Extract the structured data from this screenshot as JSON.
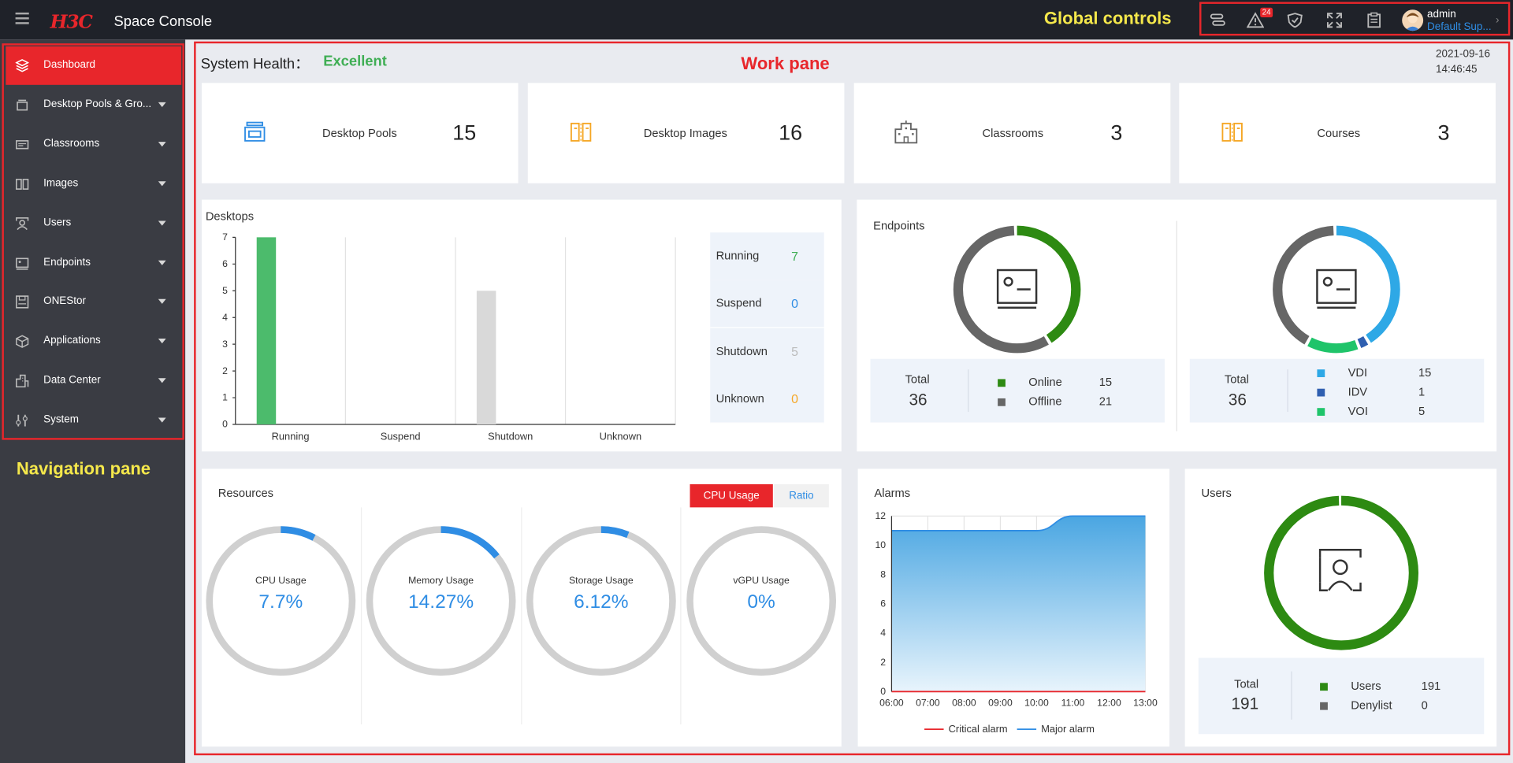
{
  "header": {
    "logo": "H3C",
    "title": "Space Console",
    "alarm_count": "24",
    "user_name": "admin",
    "user_role": "Default Sup...",
    "icons": [
      "task-icon",
      "alarm-icon",
      "shield-icon",
      "fullscreen-icon",
      "clipboard-icon",
      "avatar",
      "chevron-right-icon"
    ]
  },
  "annotations": {
    "global_controls": "Global controls",
    "work_pane": "Work pane",
    "navigation_pane": "Navigation pane"
  },
  "nav": {
    "items": [
      {
        "label": "Dashboard",
        "icon": "layers-icon",
        "active": true
      },
      {
        "label": "Desktop Pools & Gro...",
        "icon": "desktop-pool-icon"
      },
      {
        "label": "Classrooms",
        "icon": "classroom-icon"
      },
      {
        "label": "Images",
        "icon": "image-icon"
      },
      {
        "label": "Users",
        "icon": "user-icon"
      },
      {
        "label": "Endpoints",
        "icon": "endpoint-icon"
      },
      {
        "label": "ONEStor",
        "icon": "storage-icon"
      },
      {
        "label": "Applications",
        "icon": "cube-icon"
      },
      {
        "label": "Data Center",
        "icon": "building-icon"
      },
      {
        "label": "System",
        "icon": "tools-icon"
      }
    ]
  },
  "health": {
    "label": "System Health：",
    "value": "Excellent"
  },
  "datetime": {
    "date": "2021-09-16",
    "time": "14:46:45"
  },
  "stats": [
    {
      "label": "Desktop Pools",
      "value": "15",
      "icon": "desktop-pool-icon",
      "color": "#2f8de4"
    },
    {
      "label": "Desktop Images",
      "value": "16",
      "icon": "image-icon",
      "color": "#f5a623"
    },
    {
      "label": "Classrooms",
      "value": "3",
      "icon": "classroom-icon",
      "color": "#666666"
    },
    {
      "label": "Courses",
      "value": "3",
      "icon": "course-icon",
      "color": "#f5a623"
    }
  ],
  "desktops": {
    "title": "Desktops",
    "status": [
      {
        "label": "Running",
        "value": "7",
        "color": "#3fae54"
      },
      {
        "label": "Suspend",
        "value": "0",
        "color": "#2f8de4"
      },
      {
        "label": "Shutdown",
        "value": "5",
        "color": "#bbbbbb"
      },
      {
        "label": "Unknown",
        "value": "0",
        "color": "#f5a623"
      }
    ]
  },
  "endpoints": {
    "title": "Endpoints",
    "total_label": "Total",
    "left": {
      "total": "36",
      "items": [
        {
          "label": "Online",
          "value": "15",
          "color": "#2d8a12"
        },
        {
          "label": "Offline",
          "value": "21",
          "color": "#666666"
        }
      ]
    },
    "right": {
      "total": "36",
      "items": [
        {
          "label": "VDI",
          "value": "15",
          "color": "#2ea8e6"
        },
        {
          "label": "IDV",
          "value": "1",
          "color": "#2f5fb0"
        },
        {
          "label": "VOI",
          "value": "5",
          "color": "#1fc46a"
        }
      ]
    }
  },
  "resources": {
    "title": "Resources",
    "tabs": [
      {
        "label": "CPU Usage",
        "active": true
      },
      {
        "label": "Ratio",
        "active": false
      }
    ],
    "gauges": [
      {
        "label": "CPU Usage",
        "value": "7.7%",
        "fraction": 0.077
      },
      {
        "label": "Memory Usage",
        "value": "14.27%",
        "fraction": 0.1427
      },
      {
        "label": "Storage Usage",
        "value": "6.12%",
        "fraction": 0.0612
      },
      {
        "label": "vGPU Usage",
        "value": "0%",
        "fraction": 0
      }
    ]
  },
  "alarms": {
    "title": "Alarms",
    "legend": [
      "Critical alarm",
      "Major alarm"
    ]
  },
  "users": {
    "title": "Users",
    "total_label": "Total",
    "total": "191",
    "items": [
      {
        "label": "Users",
        "value": "191",
        "color": "#2d8a12"
      },
      {
        "label": "Denylist",
        "value": "0",
        "color": "#666666"
      }
    ]
  },
  "chart_data": [
    {
      "type": "bar",
      "title": "Desktops",
      "categories": [
        "Running",
        "Suspend",
        "Shutdown",
        "Unknown"
      ],
      "values": [
        7,
        0,
        5,
        0
      ],
      "ylim": [
        0,
        7
      ],
      "yticks": [
        0,
        1,
        2,
        3,
        4,
        5,
        6,
        7
      ],
      "colors": [
        "#4cbb6c",
        "#2f8de4",
        "#d9d9d9",
        "#f5a623"
      ],
      "grid": true
    },
    {
      "type": "area",
      "title": "Alarms",
      "x": [
        "06:00",
        "07:00",
        "08:00",
        "09:00",
        "10:00",
        "11:00",
        "12:00",
        "13:00"
      ],
      "ylim": [
        0,
        12
      ],
      "yticks": [
        0,
        2,
        4,
        6,
        8,
        10,
        12
      ],
      "series": [
        {
          "name": "Critical alarm",
          "values": [
            0,
            0,
            0,
            0,
            0,
            0,
            0,
            0
          ],
          "color": "#e8262b"
        },
        {
          "name": "Major alarm",
          "values": [
            11,
            11,
            11,
            11,
            11,
            12,
            12,
            12
          ],
          "color": "#2f8de4"
        }
      ],
      "legend": "bottom",
      "grid": true
    },
    {
      "type": "pie",
      "title": "Endpoints",
      "categories": [
        "Online",
        "Offline"
      ],
      "values": [
        15,
        21
      ],
      "colors": [
        "#2d8a12",
        "#666666"
      ]
    },
    {
      "type": "pie",
      "title": "Endpoints",
      "categories": [
        "VDI",
        "IDV",
        "VOI"
      ],
      "values": [
        15,
        1,
        5
      ],
      "colors": [
        "#2ea8e6",
        "#2f5fb0",
        "#1fc46a"
      ],
      "remainder": 15
    },
    {
      "type": "pie",
      "title": "Users",
      "categories": [
        "Users",
        "Denylist"
      ],
      "values": [
        191,
        0
      ],
      "colors": [
        "#2d8a12",
        "#666666"
      ]
    }
  ]
}
